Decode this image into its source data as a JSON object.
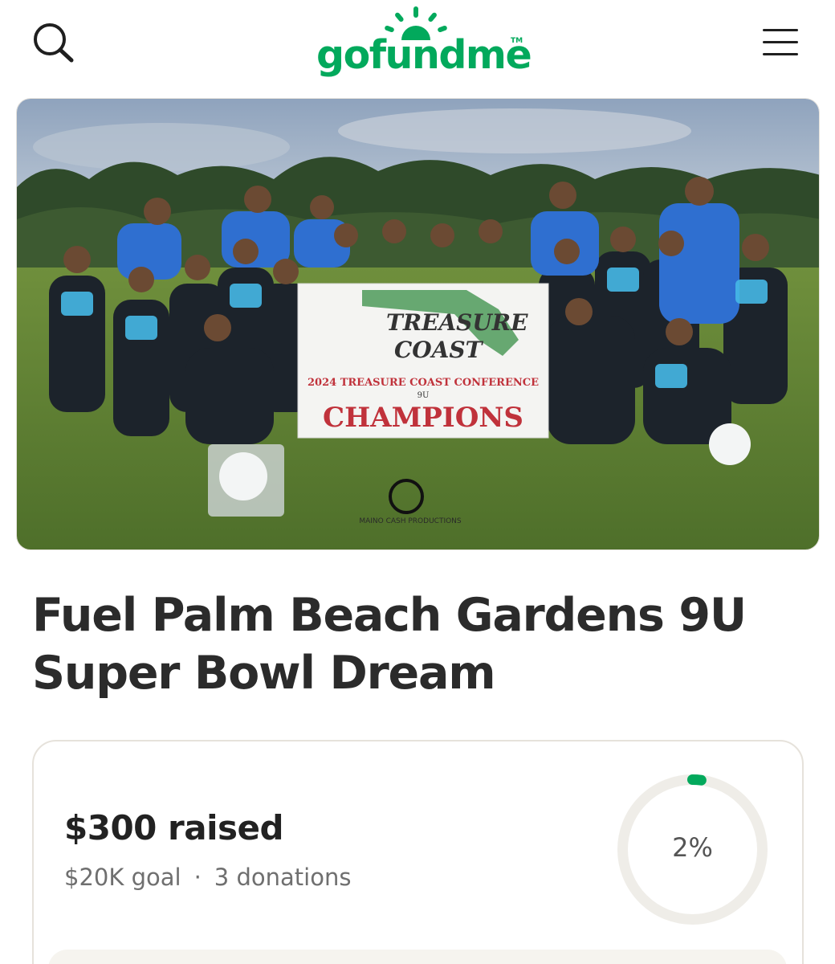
{
  "header": {
    "logo_text": "gofundme",
    "logo_tm": "TM",
    "icons": {
      "search": "search-icon",
      "menu": "hamburger-menu-icon",
      "logo": "gofundme-sun-logo-icon"
    }
  },
  "hero": {
    "banner_line_1": "TREASURE",
    "banner_line_2": "COAST",
    "banner_line_3": "2024 TREASURE COAST CONFERENCE",
    "banner_line_4": "9U",
    "banner_line_5": "CHAMPIONS",
    "watermark": "MAINO CASH PRODUCTIONS"
  },
  "fundraiser": {
    "title": "Fuel Palm Beach Gardens 9U Super Bowl Dream",
    "raised_text": "$300 raised",
    "goal_text": "$20K goal",
    "separator": "·",
    "donations_text": "3 donations",
    "progress_label": "2%",
    "progress_fraction": 0.02
  },
  "colors": {
    "brand_green": "#02a95c",
    "ring_track": "#efede8",
    "text_dark": "#2b2b2b",
    "text_muted": "#6f6f6f"
  }
}
